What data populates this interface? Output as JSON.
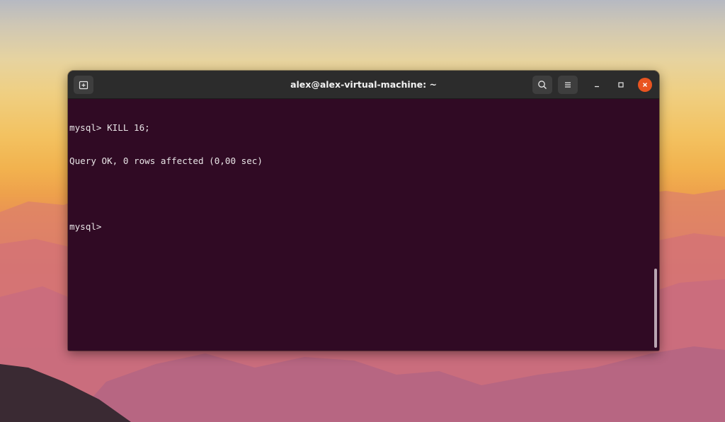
{
  "window": {
    "title": "alex@alex-virtual-machine: ~",
    "new_tab_icon": "new-tab-icon",
    "search_icon": "search-icon",
    "menu_icon": "hamburger-menu-icon",
    "minimize_icon": "minimize-icon",
    "maximize_icon": "maximize-icon",
    "close_icon": "close-icon"
  },
  "terminal": {
    "lines": [
      "mysql> KILL 16;",
      "Query OK, 0 rows affected (0,00 sec)",
      "",
      "mysql> "
    ]
  },
  "colors": {
    "terminal_bg": "#300a24",
    "titlebar_bg": "#2c2c2c",
    "close_button": "#e95420",
    "text": "#e8e4e6"
  }
}
